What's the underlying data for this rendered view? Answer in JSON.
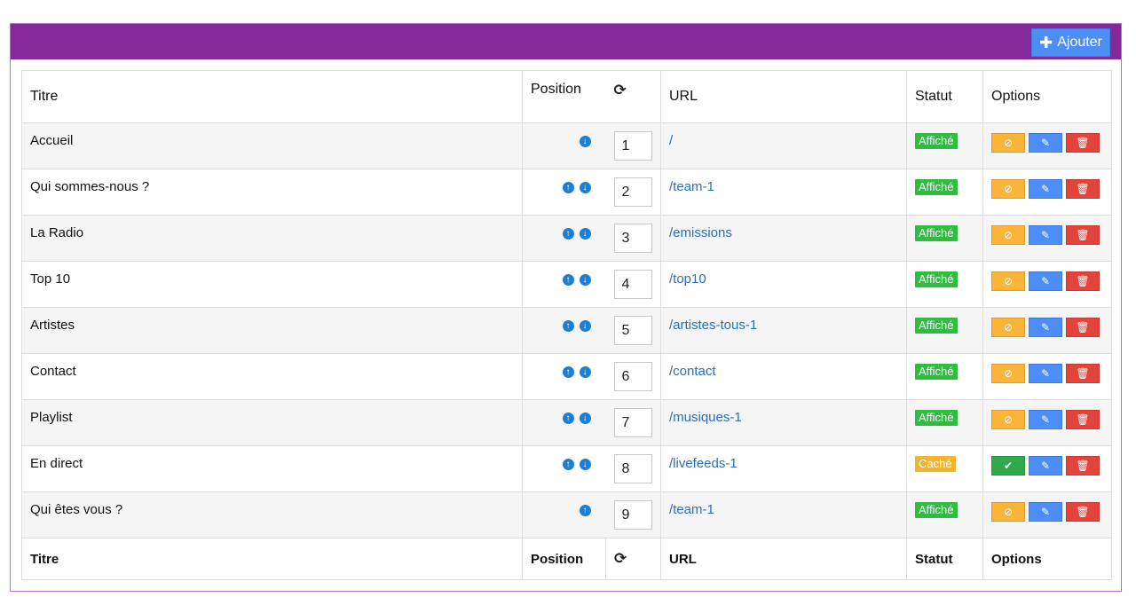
{
  "header": {
    "add_label": "Ajouter",
    "add_icon": "plus-icon"
  },
  "columns": {
    "title": "Titre",
    "position": "Position",
    "url": "URL",
    "status": "Statut",
    "options": "Options"
  },
  "rows": [
    {
      "title": "Accueil",
      "position": "1",
      "url": "/",
      "status": "Affiché",
      "status_kind": "shown",
      "up": false,
      "down": true
    },
    {
      "title": "Qui sommes-nous ?",
      "position": "2",
      "url": "/team-1",
      "status": "Affiché",
      "status_kind": "shown",
      "up": true,
      "down": true
    },
    {
      "title": "La Radio",
      "position": "3",
      "url": "/emissions",
      "status": "Affiché",
      "status_kind": "shown",
      "up": true,
      "down": true
    },
    {
      "title": "Top 10",
      "position": "4",
      "url": "/top10",
      "status": "Affiché",
      "status_kind": "shown",
      "up": true,
      "down": true
    },
    {
      "title": "Artistes",
      "position": "5",
      "url": "/artistes-tous-1",
      "status": "Affiché",
      "status_kind": "shown",
      "up": true,
      "down": true
    },
    {
      "title": "Contact",
      "position": "6",
      "url": "/contact",
      "status": "Affiché",
      "status_kind": "shown",
      "up": true,
      "down": true
    },
    {
      "title": "Playlist",
      "position": "7",
      "url": "/musiques-1",
      "status": "Affiché",
      "status_kind": "shown",
      "up": true,
      "down": true
    },
    {
      "title": "En direct",
      "position": "8",
      "url": "/livefeeds-1",
      "status": "Caché",
      "status_kind": "hidden",
      "up": true,
      "down": true
    },
    {
      "title": "Qui êtes vous ?",
      "position": "9",
      "url": "/team-1",
      "status": "Affiché",
      "status_kind": "shown",
      "up": true,
      "down": false
    }
  ],
  "colors": {
    "header_bg": "#84289a",
    "add_button": "#4c8df6",
    "badge_shown": "#2ebd3f",
    "badge_hidden": "#f7b32b",
    "btn_hide": "#fbb43a",
    "btn_show": "#2fa94a",
    "btn_edit": "#4c8df6",
    "btn_delete": "#e2433a",
    "link": "#2a6fb8"
  }
}
